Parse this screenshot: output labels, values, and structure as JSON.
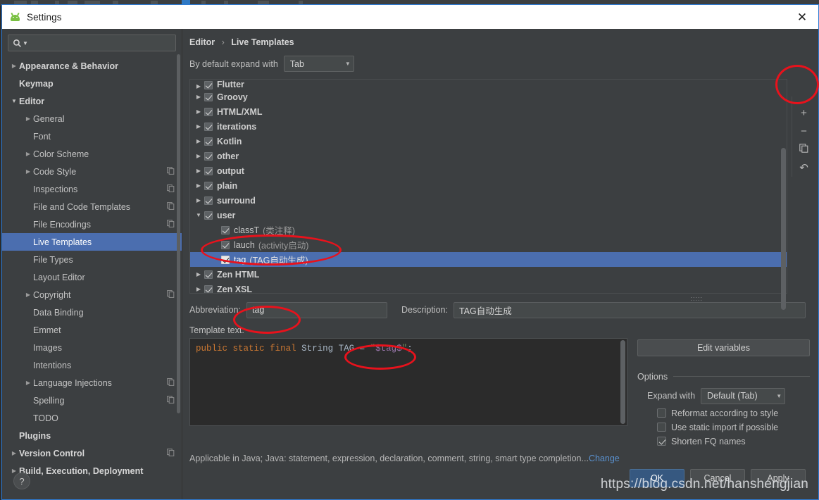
{
  "window": {
    "title": "Settings",
    "app_icon": "android-robot-icon",
    "close_label": "✕"
  },
  "sidebar": {
    "search": {
      "value": "",
      "placeholder": "",
      "icon": "search-icon"
    },
    "items": [
      {
        "label": "Appearance & Behavior",
        "indent": 0,
        "arrow": "collapsed",
        "bold": true,
        "copy": false,
        "selected": false
      },
      {
        "label": "Keymap",
        "indent": 0,
        "arrow": "none",
        "bold": true,
        "copy": false,
        "selected": false
      },
      {
        "label": "Editor",
        "indent": 0,
        "arrow": "expanded",
        "bold": true,
        "copy": false,
        "selected": false
      },
      {
        "label": "General",
        "indent": 1,
        "arrow": "collapsed",
        "bold": false,
        "copy": false,
        "selected": false
      },
      {
        "label": "Font",
        "indent": 1,
        "arrow": "none",
        "bold": false,
        "copy": false,
        "selected": false
      },
      {
        "label": "Color Scheme",
        "indent": 1,
        "arrow": "collapsed",
        "bold": false,
        "copy": false,
        "selected": false
      },
      {
        "label": "Code Style",
        "indent": 1,
        "arrow": "collapsed",
        "bold": false,
        "copy": true,
        "selected": false
      },
      {
        "label": "Inspections",
        "indent": 1,
        "arrow": "none",
        "bold": false,
        "copy": true,
        "selected": false
      },
      {
        "label": "File and Code Templates",
        "indent": 1,
        "arrow": "none",
        "bold": false,
        "copy": true,
        "selected": false
      },
      {
        "label": "File Encodings",
        "indent": 1,
        "arrow": "none",
        "bold": false,
        "copy": true,
        "selected": false
      },
      {
        "label": "Live Templates",
        "indent": 1,
        "arrow": "none",
        "bold": false,
        "copy": false,
        "selected": true
      },
      {
        "label": "File Types",
        "indent": 1,
        "arrow": "none",
        "bold": false,
        "copy": false,
        "selected": false
      },
      {
        "label": "Layout Editor",
        "indent": 1,
        "arrow": "none",
        "bold": false,
        "copy": false,
        "selected": false
      },
      {
        "label": "Copyright",
        "indent": 1,
        "arrow": "collapsed",
        "bold": false,
        "copy": true,
        "selected": false
      },
      {
        "label": "Data Binding",
        "indent": 1,
        "arrow": "none",
        "bold": false,
        "copy": false,
        "selected": false
      },
      {
        "label": "Emmet",
        "indent": 1,
        "arrow": "none",
        "bold": false,
        "copy": false,
        "selected": false
      },
      {
        "label": "Images",
        "indent": 1,
        "arrow": "none",
        "bold": false,
        "copy": false,
        "selected": false
      },
      {
        "label": "Intentions",
        "indent": 1,
        "arrow": "none",
        "bold": false,
        "copy": false,
        "selected": false
      },
      {
        "label": "Language Injections",
        "indent": 1,
        "arrow": "collapsed",
        "bold": false,
        "copy": true,
        "selected": false
      },
      {
        "label": "Spelling",
        "indent": 1,
        "arrow": "none",
        "bold": false,
        "copy": true,
        "selected": false
      },
      {
        "label": "TODO",
        "indent": 1,
        "arrow": "none",
        "bold": false,
        "copy": false,
        "selected": false
      },
      {
        "label": "Plugins",
        "indent": 0,
        "arrow": "none",
        "bold": true,
        "copy": false,
        "selected": false
      },
      {
        "label": "Version Control",
        "indent": 0,
        "arrow": "collapsed",
        "bold": true,
        "copy": true,
        "selected": false
      },
      {
        "label": "Build, Execution, Deployment",
        "indent": 0,
        "arrow": "collapsed",
        "bold": true,
        "copy": false,
        "selected": false
      }
    ],
    "help_button": {
      "label": "?",
      "icon": "question-mark-icon"
    }
  },
  "main": {
    "breadcrumb": {
      "parent": "Editor",
      "separator": "›",
      "current": "Live Templates"
    },
    "expand_with": {
      "label": "By default expand with",
      "value": "Tab"
    },
    "template_groups": [
      {
        "label": "Flutter",
        "desc": "",
        "checked": true,
        "arrow": "collapsed",
        "child": false,
        "selected": false
      },
      {
        "label": "Groovy",
        "desc": "",
        "checked": true,
        "arrow": "collapsed",
        "child": false,
        "selected": false
      },
      {
        "label": "HTML/XML",
        "desc": "",
        "checked": true,
        "arrow": "collapsed",
        "child": false,
        "selected": false
      },
      {
        "label": "iterations",
        "desc": "",
        "checked": true,
        "arrow": "collapsed",
        "child": false,
        "selected": false
      },
      {
        "label": "Kotlin",
        "desc": "",
        "checked": true,
        "arrow": "collapsed",
        "child": false,
        "selected": false
      },
      {
        "label": "other",
        "desc": "",
        "checked": true,
        "arrow": "collapsed",
        "child": false,
        "selected": false
      },
      {
        "label": "output",
        "desc": "",
        "checked": true,
        "arrow": "collapsed",
        "child": false,
        "selected": false
      },
      {
        "label": "plain",
        "desc": "",
        "checked": true,
        "arrow": "collapsed",
        "child": false,
        "selected": false
      },
      {
        "label": "surround",
        "desc": "",
        "checked": true,
        "arrow": "collapsed",
        "child": false,
        "selected": false
      },
      {
        "label": "user",
        "desc": "",
        "checked": true,
        "arrow": "expanded",
        "child": false,
        "selected": false
      },
      {
        "label": "classT",
        "desc": "(类注释)",
        "checked": true,
        "arrow": "none",
        "child": true,
        "selected": false
      },
      {
        "label": "lauch",
        "desc": "(activity启动)",
        "checked": true,
        "arrow": "none",
        "child": true,
        "selected": false
      },
      {
        "label": "tag",
        "desc": "(TAG自动生成)",
        "checked": true,
        "arrow": "none",
        "child": true,
        "selected": true
      },
      {
        "label": "Zen HTML",
        "desc": "",
        "checked": true,
        "arrow": "collapsed",
        "child": false,
        "selected": false
      },
      {
        "label": "Zen XSL",
        "desc": "",
        "checked": true,
        "arrow": "collapsed",
        "child": false,
        "selected": false
      }
    ],
    "side_toolbar": [
      {
        "name": "add-button",
        "icon": "plus-icon",
        "glyph": "+"
      },
      {
        "name": "remove-button",
        "icon": "minus-icon",
        "glyph": "−"
      },
      {
        "name": "duplicate-button",
        "icon": "copy-icon",
        "glyph": ""
      },
      {
        "name": "revert-button",
        "icon": "undo-icon",
        "glyph": "↶"
      }
    ],
    "abbreviation": {
      "label": "Abbreviation:",
      "value": "tag"
    },
    "description": {
      "label": "Description:",
      "value": "TAG自动生成"
    },
    "template_text": {
      "label": "Template text:",
      "tokens": [
        {
          "t": "public",
          "c": "kw"
        },
        {
          "t": " ",
          "c": "op"
        },
        {
          "t": "static",
          "c": "kw"
        },
        {
          "t": " ",
          "c": "op"
        },
        {
          "t": "final",
          "c": "kw"
        },
        {
          "t": " ",
          "c": "op"
        },
        {
          "t": "String",
          "c": "ty"
        },
        {
          "t": " TAG ",
          "c": "ty"
        },
        {
          "t": "= ",
          "c": "op"
        },
        {
          "t": "\"",
          "c": "q"
        },
        {
          "t": "$tag$",
          "c": "var"
        },
        {
          "t": "\"",
          "c": "q"
        },
        {
          "t": ";",
          "c": "op"
        }
      ],
      "plain": "public static final String TAG = \"$tag$\";"
    },
    "edit_variables_label": "Edit variables",
    "options": {
      "title": "Options",
      "expand_with": {
        "label": "Expand with",
        "value": "Default (Tab)"
      },
      "checkboxes": [
        {
          "label": "Reformat according to style",
          "checked": false,
          "mnemonic": "R"
        },
        {
          "label": "Use static import if possible",
          "checked": false,
          "mnemonic": "i"
        },
        {
          "label": "Shorten FQ names",
          "checked": true,
          "mnemonic": "FQ"
        }
      ]
    },
    "applicable": {
      "text": "Applicable in Java; Java: statement, expression, declaration, comment, string, smart type completion...",
      "link": "Change"
    }
  },
  "footer": {
    "buttons": [
      {
        "label": "OK",
        "primary": true
      },
      {
        "label": "Cancel",
        "primary": false
      },
      {
        "label": "Apply",
        "primary": false
      }
    ]
  },
  "watermark": {
    "text": "https://blog.csdn.net/hanshengjian"
  },
  "colors": {
    "accent_selection": "#4b6eaf",
    "dialog_bg": "#3c3f41",
    "code_bg": "#2b2b2b",
    "annotation_red": "#e8121c",
    "link_blue": "#5a91cf",
    "primary_button": "#365880"
  }
}
